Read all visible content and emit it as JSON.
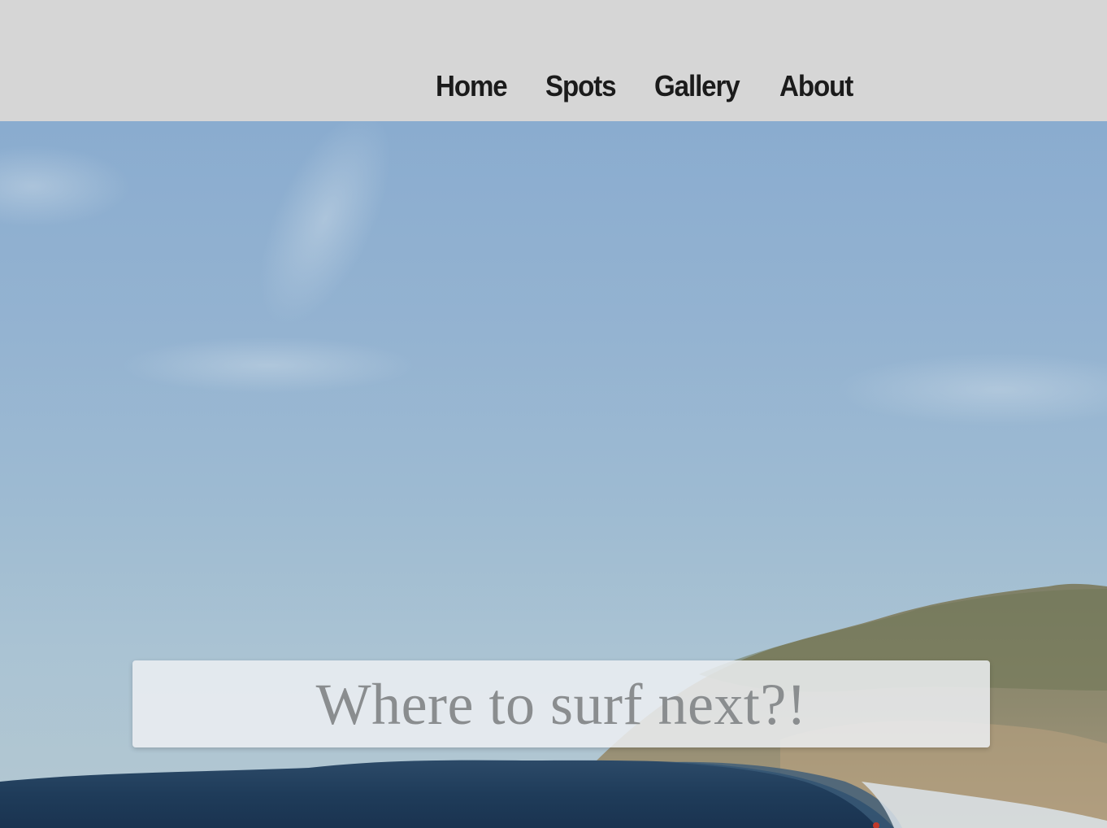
{
  "nav": {
    "items": [
      {
        "label": "Home"
      },
      {
        "label": "Spots"
      },
      {
        "label": "Gallery"
      },
      {
        "label": "About"
      }
    ]
  },
  "hero": {
    "headline": "Where to surf next?!",
    "image": "surfer riding a barrel wave beside a forested headland under a pale blue sky"
  },
  "colors": {
    "navbar_background": "#d6d6d6",
    "nav_text": "#1b1b1b",
    "headline_text": "#8a8d8f",
    "headline_box": "#eceff2"
  }
}
